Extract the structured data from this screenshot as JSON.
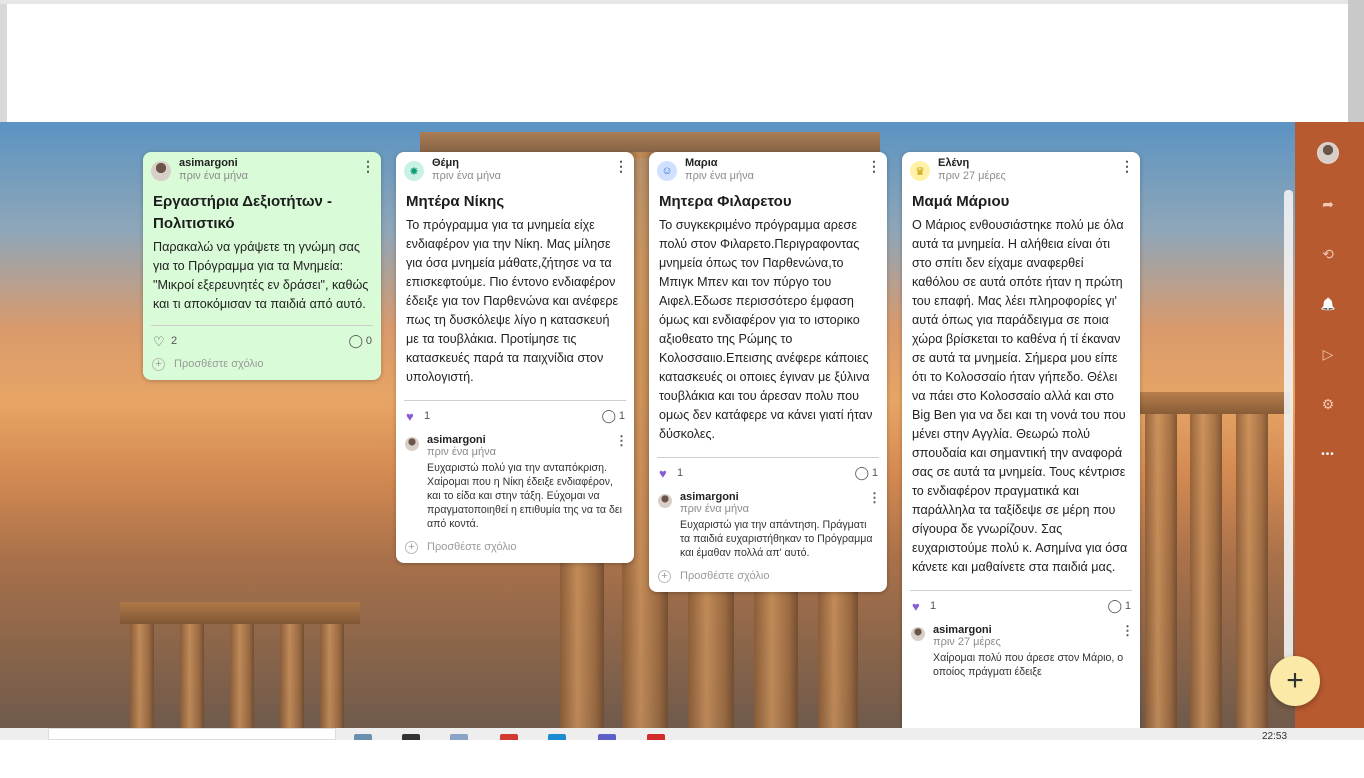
{
  "cards": [
    {
      "author": "asimargoni",
      "time": "πριν ένα μήνα",
      "title": "Εργαστήρια Δεξιοτήτων - Πολιτιστικό",
      "body": "Παρακαλώ να γράψετε τη γνώμη σας για το Πρόγραμμα για τα Μνημεία: \"Μικροί εξερευνητές εν δράσει\", καθώς και τι αποκόμισαν τα παιδιά από αυτό.",
      "likes": "2",
      "comments": "0",
      "add_comment": "Προσθέστε σχόλιο"
    },
    {
      "author": "Θέμη",
      "time": "πριν ένα μήνα",
      "title": "Μητέρα Νίκης",
      "body": "Το πρόγραμμα για τα μνημεία είχε ενδιαφέρον για την Νίκη. Μας μίλησε για όσα μνημεία μάθατε,ζήτησε να τα επισκεφτούμε. Πιο έντονο ενδιαφέρον έδειξε για τον Παρθενώνα και ανέφερε πως τη δυσκόλεψε λίγο η κατασκευή με τα τουβλάκια. Προτίμησε τις κατασκευές παρά τα παιχνίδια στον υπολογιστή.",
      "likes": "1",
      "comments": "1",
      "reply": {
        "author": "asimargoni",
        "time": "πριν ένα μήνα",
        "text": "Ευχαριστώ πολύ για την ανταπόκριση. Χαίρομαι που η Νίκη έδειξε ενδιαφέρον, και το είδα και στην τάξη. Εύχομαι να πραγματοποιηθεί η επιθυμία της να τα δει από κοντά."
      },
      "add_comment": "Προσθέστε σχόλιο"
    },
    {
      "author": "Μαρια",
      "time": "πριν ένα μήνα",
      "title": "Μητερα Φιλαρετου",
      "body": "Το συγκεκριμένο πρόγραμμα αρεσε πολύ στον Φιλαρετο.Περιγραφοντας μνημεία όπως τον Παρθενώνα,το Μπιγκ Μπεν και τον πύργο του Αιφελ.Εδωσε περισσότερο έμφαση όμως και ενδιαφέρον για το ιστορικο αξιοθεατο της Ρώμης το Κολοσσαιιο.Επεισης ανέφερε κάποιες κατασκευές οι οποιες έγιναν με ξύλινα τουβλάκια και του άρεσαν πολυ που ομως δεν κατάφερε να κάνει γιατί ήταν δύσκολες.",
      "likes": "1",
      "comments": "1",
      "reply": {
        "author": "asimargoni",
        "time": "πριν ένα μήνα",
        "text": "Ευχαριστώ για την απάντηση. Πράγματι τα παιδιά ευχαριστήθηκαν το Πρόγραμμα και έμαθαν πολλά απ' αυτό."
      },
      "add_comment": "Προσθέστε σχόλιο"
    },
    {
      "author": "Ελένη",
      "time": "πριν 27 μέρες",
      "title": "Μαμά Μάριου",
      "body": "Ο Μάριος ενθουσιάστηκε πολύ με όλα αυτά τα μνημεία. Η αλήθεια είναι ότι στο σπίτι δεν είχαμε αναφερθεί καθόλου σε αυτά οπότε ήταν η πρώτη του επαφή. Μας λέει πληροφορίες γι' αυτά όπως για παράδειγμα σε ποια χώρα βρίσκεται το καθένα ή τί έκαναν σε αυτά τα μνημεία. Σήμερα μου είπε ότι το Κολοσσαίο ήταν γήπεδο. Θέλει να πάει στο Κολοσσαίο αλλά και στο Big Ben για να δει και τη νονά του που μένει στην Αγγλία. Θεωρώ πολύ σπουδαία και σημαντική την αναφορά σας σε αυτά τα μνημεία. Τους κέντρισε το ενδιαφέρον πραγματικά και παράλληλα τα ταξίδεψε σε μέρη που σίγουρα δε γνωρίζουν. Σας ευχαριστούμε πολύ κ. Ασημίνα για όσα κάνετε και μαθαίνετε στα παιδιά μας.",
      "likes": "1",
      "comments": "1",
      "reply": {
        "author": "asimargoni",
        "time": "πριν 27 μέρες",
        "text": "Χαίρομαι πολύ που άρεσε στον Μάριο, ο οποίος πράγματι έδειξε"
      }
    }
  ],
  "icons": {
    "menu": "⋮",
    "heart_outline": "♡",
    "heart_filled": "♥",
    "comment": "◯",
    "plus": "+",
    "fab_plus": "+",
    "share": "➦",
    "remake": "⟲",
    "bell": "🔔",
    "play": "▷",
    "settings": "⚙",
    "more": "•••"
  },
  "colors": {
    "sidebar": "#b75a30",
    "accent_heart": "#8a5bd6",
    "fab": "#fbe9a7",
    "green_card": "#d9fbd7"
  },
  "taskbar": {
    "clock": "22:53"
  }
}
